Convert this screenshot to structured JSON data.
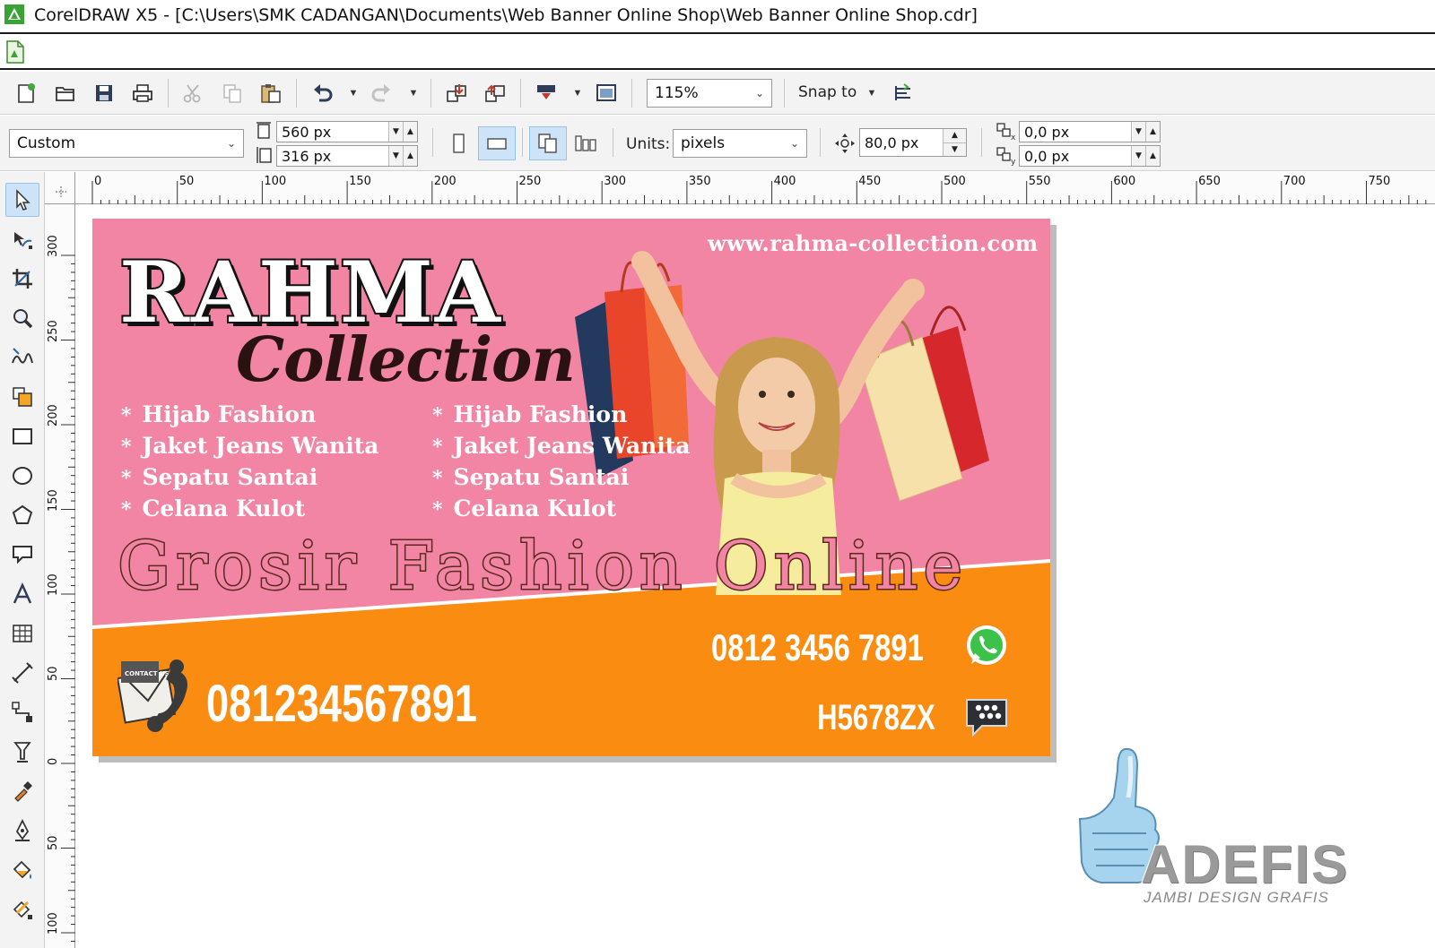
{
  "window": {
    "title": "CorelDRAW X5 - [C:\\Users\\SMK CADANGAN\\Documents\\Web Banner Online Shop\\Web Banner Online Shop.cdr]"
  },
  "standard_toolbar": {
    "zoom_value": "115%",
    "snap_to_label": "Snap to"
  },
  "property_bar": {
    "page_preset": "Custom",
    "page_width": "560 px",
    "page_height": "316 px",
    "units_label": "Units:",
    "units_value": "pixels",
    "nudge_value": "80,0 px",
    "dup_x": "0,0 px",
    "dup_y": "0,0 px"
  },
  "rulers": {
    "horizontal_labels": [
      "0",
      "50",
      "100",
      "150",
      "200",
      "250",
      "300",
      "350",
      "400",
      "450",
      "500",
      "550",
      "600",
      "650",
      "700",
      "750"
    ],
    "vertical_labels": [
      "300",
      "250",
      "200",
      "150",
      "100",
      "50",
      "0",
      "50",
      "100"
    ]
  },
  "banner": {
    "url": "www.rahma-collection.com",
    "brand": "RAHMA",
    "brand_sub": "Collection",
    "list_left": [
      "Hijab Fashion",
      "Jaket Jeans Wanita",
      "Sepatu Santai",
      "Celana Kulot"
    ],
    "list_right": [
      "Hijab Fashion",
      "Jaket Jeans Wanita",
      "Sepatu Santai",
      "Celana Kulot"
    ],
    "bullet": "*",
    "headline": "Grosir Fashion Online",
    "phone_whatsapp": "0812 3456 7891",
    "bbm_pin": "H5678ZX",
    "phone_contact": "081234567891",
    "contact_badge": "CONTACT US",
    "colors": {
      "pink": "#f285a3",
      "orange": "#fb8c12",
      "whatsapp_green": "#3cc24a"
    }
  },
  "watermark": {
    "brand": "ADEFIS",
    "tagline": "JAMBI DESIGN GRAFIS"
  },
  "icons": {
    "tools": [
      "pick-tool-icon",
      "shape-tool-icon",
      "crop-tool-icon",
      "zoom-tool-icon",
      "freehand-tool-icon",
      "smart-fill-icon",
      "rectangle-tool-icon",
      "ellipse-tool-icon",
      "polygon-tool-icon",
      "basic-shapes-icon",
      "text-tool-icon",
      "table-tool-icon",
      "dimension-tool-icon",
      "connector-tool-icon",
      "blend-tool-icon",
      "eyedropper-tool-icon",
      "outline-pen-icon",
      "fill-tool-icon",
      "interactive-fill-icon"
    ]
  }
}
